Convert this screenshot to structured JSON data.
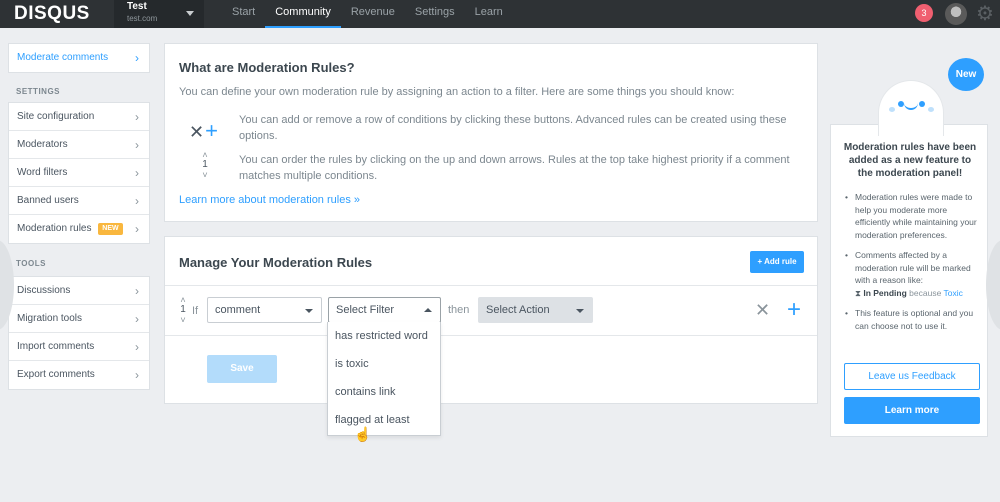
{
  "topbar": {
    "logo": "DISQUS",
    "site_name": "Test",
    "site_url": "test.com",
    "nav": [
      "Start",
      "Community",
      "Revenue",
      "Settings",
      "Learn"
    ],
    "active_nav": "Community",
    "notification_count": "3"
  },
  "sidebar": {
    "top": [
      {
        "label": "Moderate comments"
      }
    ],
    "settings_heading": "SETTINGS",
    "settings": [
      {
        "label": "Site configuration"
      },
      {
        "label": "Moderators"
      },
      {
        "label": "Word filters"
      },
      {
        "label": "Banned users"
      },
      {
        "label": "Moderation rules",
        "badge": "NEW"
      }
    ],
    "tools_heading": "TOOLS",
    "tools": [
      {
        "label": "Discussions"
      },
      {
        "label": "Migration tools"
      },
      {
        "label": "Import comments"
      },
      {
        "label": "Export comments"
      }
    ]
  },
  "info": {
    "title": "What are Moderation Rules?",
    "intro": "You can define your own moderation rule by assigning an action to a filter. Here are some things you should know:",
    "point1": "You can add or remove a row of conditions by clicking these buttons. Advanced rules can be created using these options.",
    "point2": "You can order the rules by clicking on the up and down arrows. Rules at the top take highest priority if a comment matches multiple conditions.",
    "order_number": "1",
    "learn_link": "Learn more about moderation rules »"
  },
  "manage": {
    "title": "Manage Your Moderation Rules",
    "add_rule": "+ Add rule",
    "rule_number": "1",
    "if_label": "If",
    "subject_value": "comment",
    "filter_placeholder": "Select Filter",
    "then_label": "then",
    "action_placeholder": "Select Action",
    "save": "Save",
    "filter_options": [
      "has restricted word",
      "is toxic",
      "contains link",
      "flagged at least"
    ]
  },
  "promo": {
    "new_badge": "New",
    "title": "Moderation rules have been added as a new feature to the moderation panel!",
    "bullet1": "Moderation rules were made to help you moderate more efficiently while maintaining your moderation preferences.",
    "bullet2_prefix": "Comments affected by a moderation rule will be marked with a reason like:",
    "bullet2_pending": "In Pending",
    "bullet2_because": "because",
    "bullet2_toxic": "Toxic",
    "bullet3": "This feature is optional and you can choose not to use it.",
    "feedback_button": "Leave us Feedback",
    "learn_button": "Learn more"
  },
  "colors": {
    "accent": "#2e9fff",
    "topbar": "#2e3235",
    "badge_new": "#f9b73e",
    "notification": "#f05f70"
  }
}
